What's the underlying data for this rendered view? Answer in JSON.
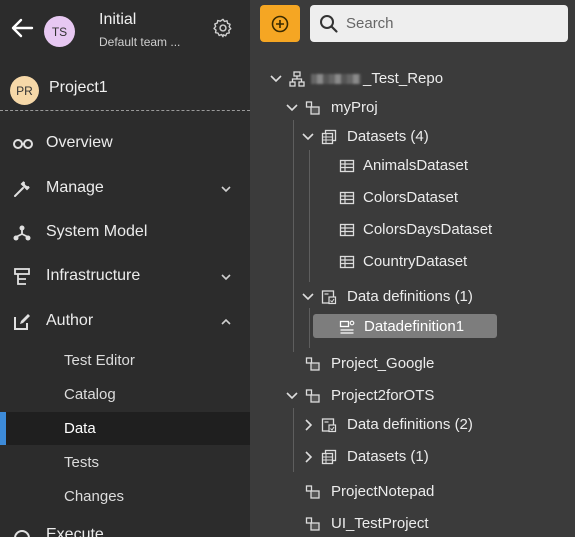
{
  "sidebar": {
    "org_initials": "TS",
    "org_name": "Initial",
    "team_name": "Default team ...",
    "project_initials": "PR",
    "project_name": "Project1",
    "nav": {
      "overview": "Overview",
      "manage": "Manage",
      "system_model": "System Model",
      "infrastructure": "Infrastructure",
      "author": "Author",
      "execute": "Execute"
    },
    "author_sub": {
      "test_editor": "Test Editor",
      "catalog": "Catalog",
      "data": "Data",
      "tests": "Tests",
      "changes": "Changes"
    }
  },
  "toolbar": {
    "search_placeholder": "Search"
  },
  "tree": {
    "repo": "_Test_Repo",
    "myproj": "myProj",
    "datasets": "Datasets (4)",
    "animals": "AnimalsDataset",
    "colors": "ColorsDataset",
    "colorsdays": "ColorsDaysDataset",
    "country": "CountryDataset",
    "data_defs": "Data definitions (1)",
    "datadef1": "Datadefinition1",
    "project_google": "Project_Google",
    "project2": "Project2forOTS",
    "p2_data_defs": "Data definitions (2)",
    "p2_datasets": "Datasets (1)",
    "project_notepad": "ProjectNotepad",
    "ui_test": "UI_TestProject"
  },
  "colors": {
    "accent": "#f5a623",
    "active_indicator": "#3d8bd9",
    "sidebar_bg": "#2c2c2c",
    "panel_bg": "#3b3b3b"
  }
}
